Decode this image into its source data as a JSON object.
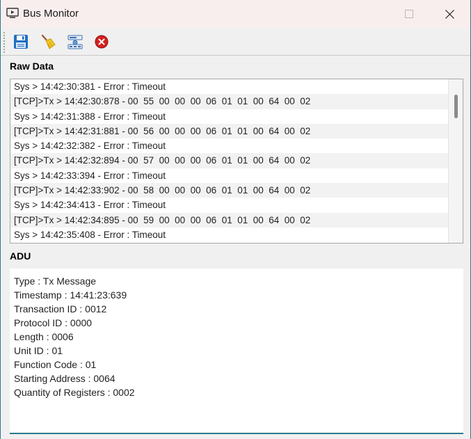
{
  "window": {
    "title": "Bus Monitor",
    "icons": {
      "app": "monitor-play-icon",
      "minimize": "minimize-icon",
      "maximize": "maximize-icon",
      "close": "close-icon"
    }
  },
  "toolbar": {
    "buttons": [
      {
        "name": "save",
        "icon": "floppy-disk-icon"
      },
      {
        "name": "clear",
        "icon": "broom-icon"
      },
      {
        "name": "connection",
        "icon": "network-icon"
      },
      {
        "name": "stop",
        "icon": "stop-icon"
      }
    ]
  },
  "raw_data": {
    "label": "Raw Data",
    "rows": [
      "Sys > 14:42:30:381 - Error : Timeout",
      "[TCP]>Tx > 14:42:30:878 - 00  55  00  00  00  06  01  01  00  64  00  02",
      "Sys > 14:42:31:388 - Error : Timeout",
      "[TCP]>Tx > 14:42:31:881 - 00  56  00  00  00  06  01  01  00  64  00  02",
      "Sys > 14:42:32:382 - Error : Timeout",
      "[TCP]>Tx > 14:42:32:894 - 00  57  00  00  00  06  01  01  00  64  00  02",
      "Sys > 14:42:33:394 - Error : Timeout",
      "[TCP]>Tx > 14:42:33:902 - 00  58  00  00  00  06  01  01  00  64  00  02",
      "Sys > 14:42:34:413 - Error : Timeout",
      "[TCP]>Tx > 14:42:34:895 - 00  59  00  00  00  06  01  01  00  64  00  02",
      "Sys > 14:42:35:408 - Error : Timeout"
    ]
  },
  "adu": {
    "label": "ADU",
    "lines": [
      "Type : Tx Message",
      "Timestamp : 14:41:23:639",
      "Transaction ID : 0012",
      "Protocol ID : 0000",
      "Length : 0006",
      "Unit ID : 01",
      "Function Code : 01",
      "Starting Address : 0064",
      "Quantity of Registers : 0002"
    ]
  },
  "colors": {
    "accent": "#2b7a8a",
    "titlebar": "#f9eeee",
    "row_alt": "#f2f2f2",
    "stop_red": "#d42020",
    "save_blue": "#1f6fc0"
  }
}
